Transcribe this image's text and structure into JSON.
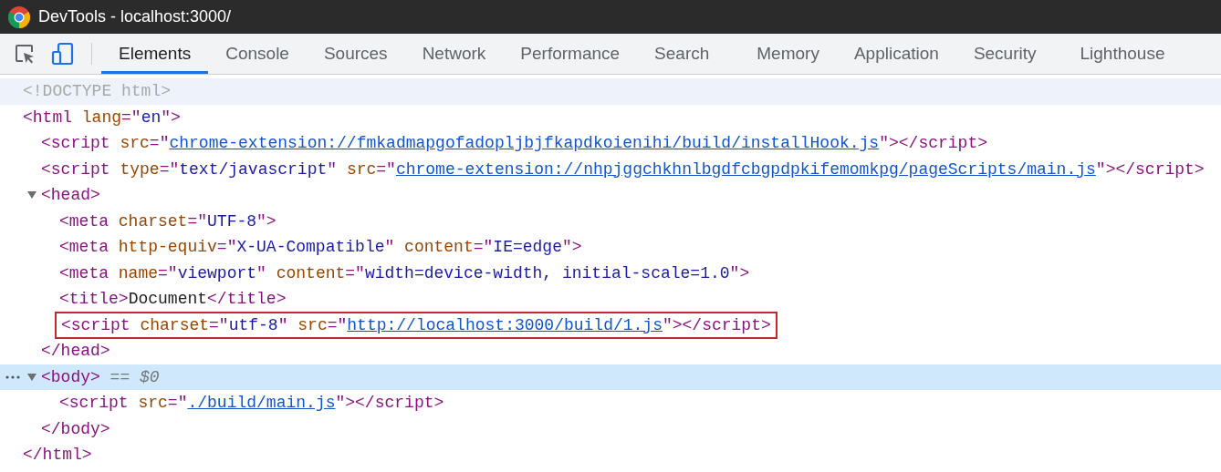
{
  "window": {
    "title": "DevTools - localhost:3000/"
  },
  "tabs": [
    {
      "label": "Elements",
      "selected": true
    },
    {
      "label": "Console",
      "selected": false
    },
    {
      "label": "Sources",
      "selected": false
    },
    {
      "label": "Network",
      "selected": false
    },
    {
      "label": "Performance",
      "selected": false
    },
    {
      "label": "Search",
      "selected": false
    },
    {
      "label": "Memory",
      "selected": false
    },
    {
      "label": "Application",
      "selected": false
    },
    {
      "label": "Security",
      "selected": false
    },
    {
      "label": "Lighthouse",
      "selected": false
    }
  ],
  "dom_tree": [
    {
      "hovered": true,
      "selected": false,
      "outlined": false,
      "parts": [
        {
          "kind": "doctype",
          "text": "<!DOCTYPE html>"
        }
      ]
    },
    {
      "hovered": false,
      "selected": false,
      "outlined": false,
      "parts": [
        {
          "kind": "tag",
          "text": "<html "
        },
        {
          "kind": "attr",
          "text": "lang"
        },
        {
          "kind": "tag",
          "text": "=\""
        },
        {
          "kind": "value",
          "text": "en"
        },
        {
          "kind": "tag",
          "text": "\">"
        }
      ],
      "closing": [
        {
          "kind": "tag",
          "text": "</html>"
        }
      ],
      "children": [
        {
          "hovered": false,
          "selected": false,
          "outlined": false,
          "parts": [
            {
              "kind": "tag",
              "text": "<script "
            },
            {
              "kind": "attr",
              "text": "src"
            },
            {
              "kind": "tag",
              "text": "=\""
            },
            {
              "kind": "link",
              "text": "chrome-extension://fmkadmapgofadopljbjfkapdkoienihi/build/installHook.js"
            },
            {
              "kind": "tag",
              "text": "\"></script>"
            }
          ]
        },
        {
          "hovered": false,
          "selected": false,
          "outlined": false,
          "parts": [
            {
              "kind": "tag",
              "text": "<script "
            },
            {
              "kind": "attr",
              "text": "type"
            },
            {
              "kind": "tag",
              "text": "=\""
            },
            {
              "kind": "value",
              "text": "text/javascript"
            },
            {
              "kind": "tag",
              "text": "\" "
            },
            {
              "kind": "attr",
              "text": "src"
            },
            {
              "kind": "tag",
              "text": "=\""
            },
            {
              "kind": "link",
              "text": "chrome-extension://nhpjggchkhnlbgdfcbgpdpkifemomkpg/pageScripts/main.js"
            },
            {
              "kind": "tag",
              "text": "\"></script>"
            }
          ]
        },
        {
          "hovered": false,
          "selected": false,
          "outlined": false,
          "expanded": true,
          "parts": [
            {
              "kind": "tag",
              "text": "<head>"
            }
          ],
          "closing": [
            {
              "kind": "tag",
              "text": "</head>"
            }
          ],
          "children": [
            {
              "hovered": false,
              "selected": false,
              "outlined": false,
              "parts": [
                {
                  "kind": "tag",
                  "text": "<meta "
                },
                {
                  "kind": "attr",
                  "text": "charset"
                },
                {
                  "kind": "tag",
                  "text": "=\""
                },
                {
                  "kind": "value",
                  "text": "UTF-8"
                },
                {
                  "kind": "tag",
                  "text": "\">"
                }
              ]
            },
            {
              "hovered": false,
              "selected": false,
              "outlined": false,
              "parts": [
                {
                  "kind": "tag",
                  "text": "<meta "
                },
                {
                  "kind": "attr",
                  "text": "http-equiv"
                },
                {
                  "kind": "tag",
                  "text": "=\""
                },
                {
                  "kind": "value",
                  "text": "X-UA-Compatible"
                },
                {
                  "kind": "tag",
                  "text": "\" "
                },
                {
                  "kind": "attr",
                  "text": "content"
                },
                {
                  "kind": "tag",
                  "text": "=\""
                },
                {
                  "kind": "value",
                  "text": "IE=edge"
                },
                {
                  "kind": "tag",
                  "text": "\">"
                }
              ]
            },
            {
              "hovered": false,
              "selected": false,
              "outlined": false,
              "parts": [
                {
                  "kind": "tag",
                  "text": "<meta "
                },
                {
                  "kind": "attr",
                  "text": "name"
                },
                {
                  "kind": "tag",
                  "text": "=\""
                },
                {
                  "kind": "value",
                  "text": "viewport"
                },
                {
                  "kind": "tag",
                  "text": "\" "
                },
                {
                  "kind": "attr",
                  "text": "content"
                },
                {
                  "kind": "tag",
                  "text": "=\""
                },
                {
                  "kind": "value",
                  "text": "width=device-width, initial-scale=1.0"
                },
                {
                  "kind": "tag",
                  "text": "\">"
                }
              ]
            },
            {
              "hovered": false,
              "selected": false,
              "outlined": false,
              "parts": [
                {
                  "kind": "tag",
                  "text": "<title>"
                },
                {
                  "kind": "text",
                  "text": "Document"
                },
                {
                  "kind": "tag",
                  "text": "</title>"
                }
              ]
            },
            {
              "hovered": false,
              "selected": false,
              "outlined": true,
              "parts": [
                {
                  "kind": "tag",
                  "text": "<script "
                },
                {
                  "kind": "attr",
                  "text": "charset"
                },
                {
                  "kind": "tag",
                  "text": "=\""
                },
                {
                  "kind": "value",
                  "text": "utf-8"
                },
                {
                  "kind": "tag",
                  "text": "\" "
                },
                {
                  "kind": "attr",
                  "text": "src"
                },
                {
                  "kind": "tag",
                  "text": "=\""
                },
                {
                  "kind": "link",
                  "text": "http://localhost:3000/build/1.js"
                },
                {
                  "kind": "tag",
                  "text": "\"></script>"
                }
              ]
            }
          ]
        },
        {
          "hovered": false,
          "selected": true,
          "outlined": false,
          "expanded": true,
          "parts": [
            {
              "kind": "tag",
              "text": "<body>"
            },
            {
              "kind": "hint",
              "text": " == $0"
            }
          ],
          "closing": [
            {
              "kind": "tag",
              "text": "</body>"
            }
          ],
          "children": [
            {
              "hovered": false,
              "selected": false,
              "outlined": false,
              "parts": [
                {
                  "kind": "tag",
                  "text": "<script "
                },
                {
                  "kind": "attr",
                  "text": "src"
                },
                {
                  "kind": "tag",
                  "text": "=\""
                },
                {
                  "kind": "link",
                  "text": "./build/main.js"
                },
                {
                  "kind": "tag",
                  "text": "\"></script>"
                }
              ]
            }
          ]
        }
      ]
    }
  ]
}
